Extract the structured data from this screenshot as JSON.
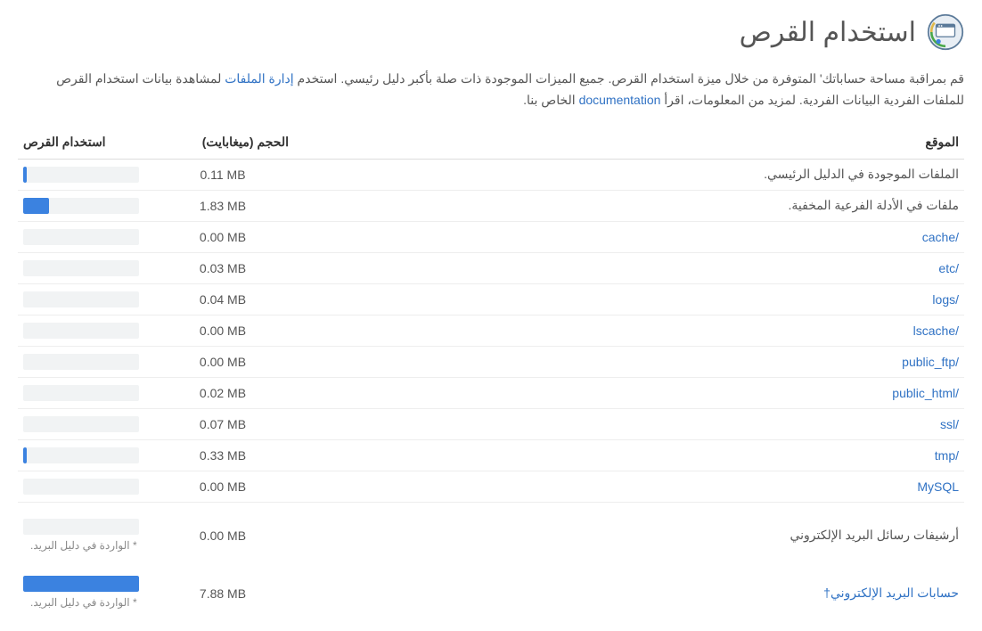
{
  "page": {
    "title": "استخدام القرص",
    "description_parts": {
      "p1": "قم بمراقبة مساحة حساباتك' المتوفرة من خلال ميزة استخدام القرص. جميع الميزات الموجودة ذات صلة بأكبر دليل رئيسي. استخدم ",
      "link1": "إدارة الملفات",
      "p2": " لمشاهدة بيانات استخدام القرص للملفات الفردية البيانات الفردية. لمزيد من المعلومات، اقرأ ",
      "link2": "documentation",
      "p3": " الخاص بنا."
    }
  },
  "table": {
    "headers": {
      "location": "الموقع",
      "size": "الحجم (ميغابايت)",
      "usage": "استخدام القرص"
    },
    "note_text": "* الواردة في دليل البريد.",
    "rows": [
      {
        "label": "الملفات الموجودة في الدليل الرئيسي.",
        "link": false,
        "size": "0.11 MB",
        "bar": 3
      },
      {
        "label": "ملفات في الأدلة الفرعية المخفية.",
        "link": false,
        "size": "1.83 MB",
        "bar": 22
      },
      {
        "label": "cache/",
        "link": true,
        "size": "0.00 MB",
        "bar": 0
      },
      {
        "label": "etc/",
        "link": true,
        "size": "0.03 MB",
        "bar": 0
      },
      {
        "label": "logs/",
        "link": true,
        "size": "0.04 MB",
        "bar": 0
      },
      {
        "label": "lscache/",
        "link": true,
        "size": "0.00 MB",
        "bar": 0
      },
      {
        "label": "public_ftp/",
        "link": true,
        "size": "0.00 MB",
        "bar": 0
      },
      {
        "label": "public_html/",
        "link": true,
        "size": "0.02 MB",
        "bar": 0
      },
      {
        "label": "ssl/",
        "link": true,
        "size": "0.07 MB",
        "bar": 0
      },
      {
        "label": "tmp/",
        "link": true,
        "size": "0.33 MB",
        "bar": 3
      },
      {
        "label": "MySQL",
        "link": true,
        "size": "0.00 MB",
        "bar": 0
      }
    ],
    "extra_rows": [
      {
        "label": "أرشيفات رسائل البريد الإلكتروني",
        "link": false,
        "size": "0.00 MB",
        "bar": 0,
        "note": true
      },
      {
        "label": "حسابات البريد الإلكتروني",
        "link": true,
        "suffix": "†",
        "size": "7.88 MB",
        "bar": 100,
        "note": true
      }
    ]
  }
}
